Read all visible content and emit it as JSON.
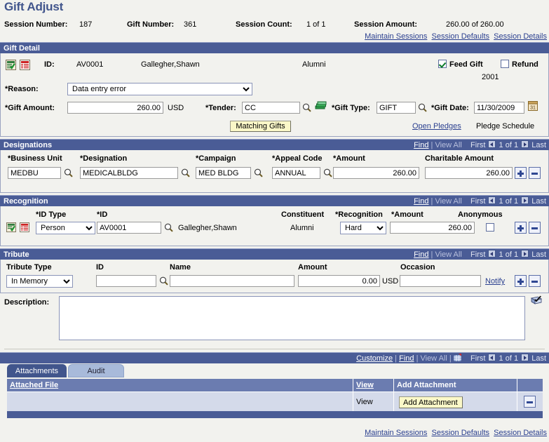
{
  "page": {
    "title": "Gift Adjust"
  },
  "header": {
    "session_number_label": "Session Number:",
    "session_number_value": "187",
    "gift_number_label": "Gift Number:",
    "gift_number_value": "361",
    "session_count_label": "Session Count:",
    "session_count_value": "1 of  1",
    "session_amount_label": "Session Amount:",
    "session_amount_value": "260.00  of   260.00",
    "links": {
      "maintain_sessions": "Maintain Sessions",
      "session_defaults": "Session Defaults",
      "session_details": "Session Details"
    }
  },
  "gift_detail": {
    "section_title": "Gift Detail",
    "id_label": "ID:",
    "id_value": "AV0001",
    "person_name": "Gallegher,Shawn",
    "constituent": "Alumni",
    "feed_gift_label": "Feed Gift",
    "feed_gift_checked": true,
    "refund_label": "Refund",
    "refund_checked": false,
    "year": "2001",
    "reason_label": "*Reason:",
    "reason_value": "Data entry error",
    "reason_options": [
      "Data entry error"
    ],
    "gift_amount_label": "*Gift Amount:",
    "gift_amount_value": "260.00",
    "currency": "USD",
    "tender_label": "*Tender:",
    "tender_value": "CC",
    "gift_type_label": "*Gift Type:",
    "gift_type_value": "GIFT",
    "gift_date_label": "*Gift Date:",
    "gift_date_value": "11/30/2009",
    "matching_gifts_button": "Matching Gifts",
    "open_pledges_link": "Open Pledges",
    "pledge_schedule_text": "Pledge Schedule"
  },
  "nav": {
    "find": "Find",
    "sep": "|",
    "view_all": "View All",
    "first": "First",
    "counter": "1 of 1",
    "last": "Last",
    "customize": "Customize"
  },
  "designations": {
    "section_title": "Designations",
    "columns": {
      "business_unit": "*Business Unit",
      "designation": "*Designation",
      "campaign": "*Campaign",
      "appeal_code": "*Appeal Code",
      "amount": "*Amount",
      "charitable_amount": "Charitable Amount"
    },
    "row": {
      "business_unit": "MEDBU",
      "designation": "MEDICALBLDG",
      "campaign": "MED BLDG",
      "appeal_code": "ANNUAL",
      "amount": "260.00",
      "charitable_amount": "260.00"
    }
  },
  "recognition": {
    "section_title": "Recognition",
    "columns": {
      "id_type": "*ID Type",
      "id": "*ID",
      "constituent": "Constituent",
      "recognition": "*Recognition",
      "amount": "*Amount",
      "anonymous": "Anonymous"
    },
    "row": {
      "id_type": "Person",
      "id_type_options": [
        "Person"
      ],
      "id": "AV0001",
      "name": "Gallegher,Shawn",
      "constituent": "Alumni",
      "recognition": "Hard",
      "recognition_options": [
        "Hard"
      ],
      "amount": "260.00",
      "anonymous_checked": false
    }
  },
  "tribute": {
    "section_title": "Tribute",
    "columns": {
      "tribute_type": "Tribute Type",
      "id": "ID",
      "name": "Name",
      "amount": "Amount",
      "occasion": "Occasion"
    },
    "row": {
      "tribute_type": "In Memory",
      "tribute_type_options": [
        "In Memory"
      ],
      "id": "",
      "name": "",
      "amount": "0.00",
      "currency": "USD",
      "occasion": "",
      "notify_link": "Notify"
    }
  },
  "description": {
    "label": "Description:",
    "value": ""
  },
  "attachments": {
    "tabs": [
      {
        "label": "Attachments",
        "active": true
      },
      {
        "label": "Audit",
        "active": false
      }
    ],
    "columns": {
      "attached_file": "Attached File",
      "view": "View",
      "add_attachment": "Add Attachment"
    },
    "row": {
      "attached_file": "",
      "view": "View",
      "add_attachment_button": "Add Attachment"
    }
  },
  "footer": {
    "maintain_sessions": "Maintain Sessions",
    "session_defaults": "Session Defaults",
    "session_details": "Session Details"
  },
  "colors": {
    "section_bar": "#4a5c96",
    "title_text": "#41558c",
    "link": "#2a3f8f",
    "grid_header": "#6b7cb0",
    "grid_row": "#d4daea",
    "button_yellow": "#fbf8c8",
    "page_bg": "#f2f2ee"
  }
}
